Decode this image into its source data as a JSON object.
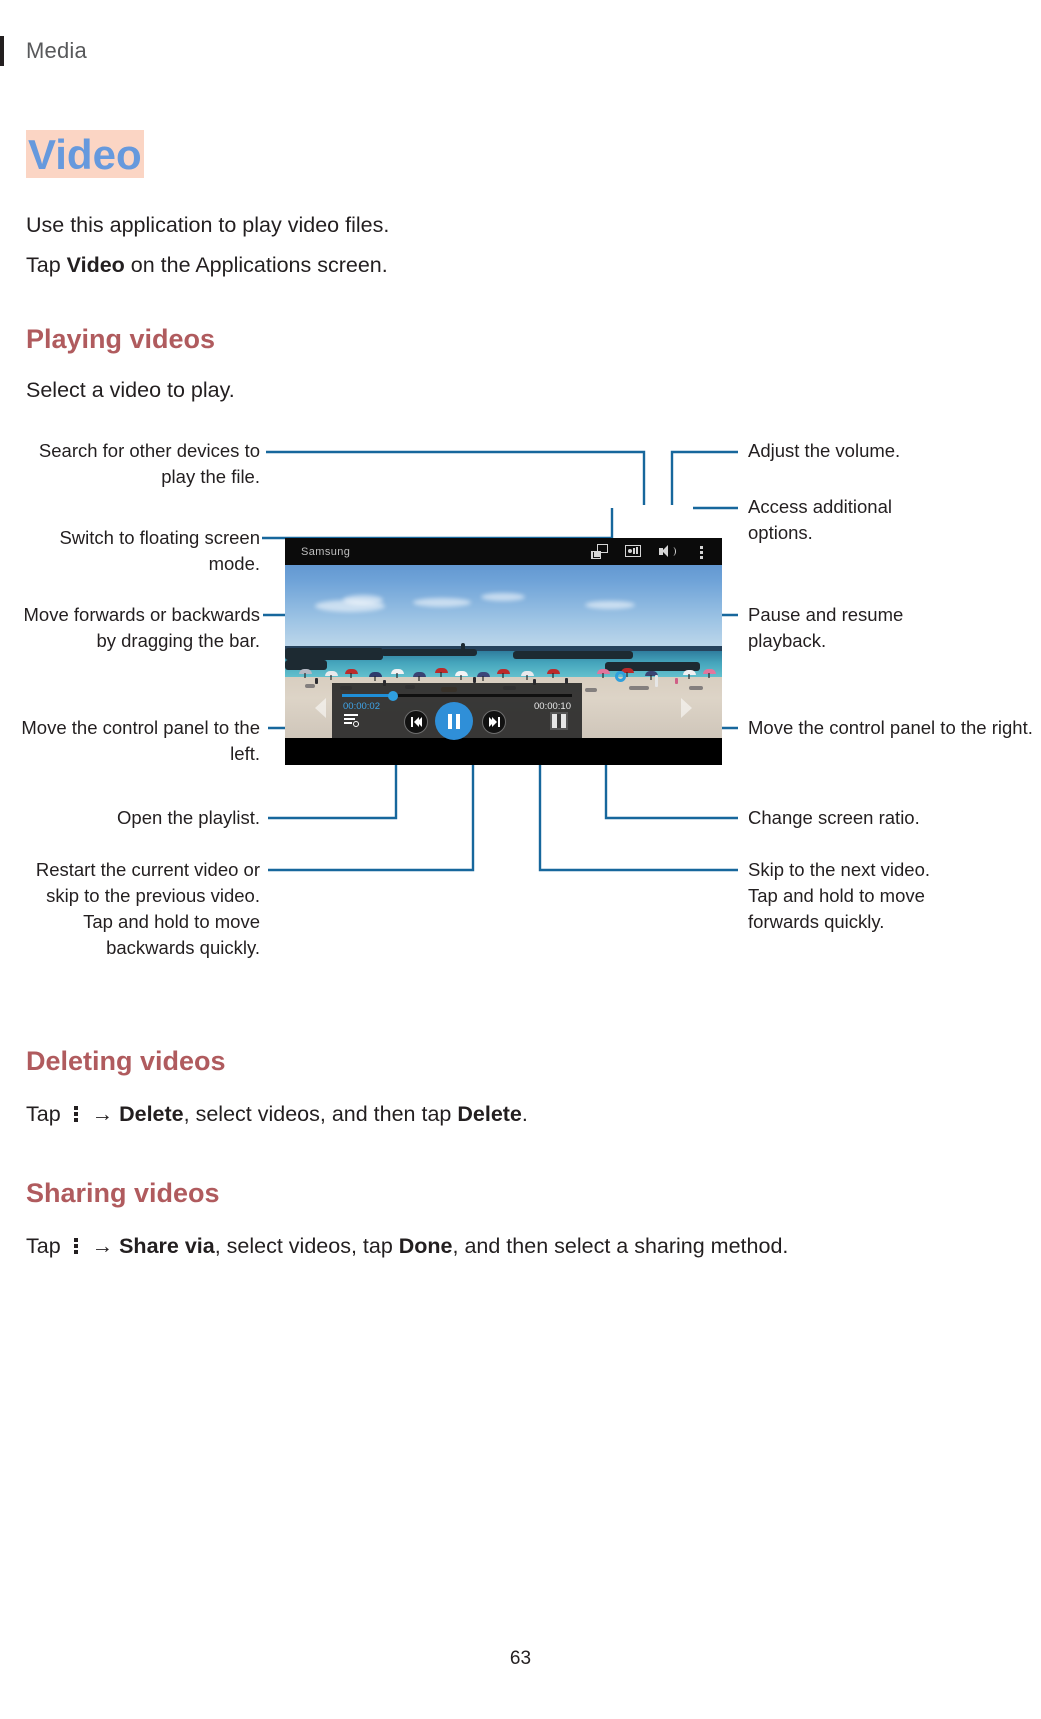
{
  "header": {
    "title": "Media"
  },
  "title": {
    "text": "Video",
    "color": "#6699dd",
    "highlight": "#fbd5c4"
  },
  "intro": {
    "line1": "Use this application to play video files.",
    "line2_pre": "Tap ",
    "line2_bold": "Video",
    "line2_post": " on the Applications screen."
  },
  "sections": {
    "playing": {
      "heading": "Playing videos",
      "body": "Select a video to play."
    },
    "deleting": {
      "heading": "Deleting videos",
      "pre": "Tap ",
      "arrow": " → ",
      "bold1": "Delete",
      "mid": ", select videos, and then tap ",
      "bold2": "Delete",
      "end": "."
    },
    "sharing": {
      "heading": "Sharing videos",
      "pre": "Tap ",
      "arrow": " → ",
      "bold1": "Share via",
      "mid": ", select videos, tap ",
      "bold2": "Done",
      "end": ", and then select a sharing method."
    }
  },
  "player": {
    "title": "Samsung",
    "current_time": "00:00:02",
    "total_time": "00:00:10",
    "progress_percent": 22,
    "accent_color": "#2f8fd8",
    "topbar_icons": [
      "floating-window-icon",
      "devices-icon",
      "volume-icon",
      "more-options-icon"
    ],
    "control_icons": [
      "playlist-icon",
      "previous-icon",
      "pause-icon",
      "next-icon",
      "screen-ratio-icon"
    ]
  },
  "callouts": {
    "left": [
      {
        "name": "search-devices",
        "text": "Search for other devices to play the file."
      },
      {
        "name": "floating-mode",
        "text": "Switch to floating screen mode."
      },
      {
        "name": "seek-bar",
        "text": "Move forwards or backwards by dragging the bar."
      },
      {
        "name": "panel-left",
        "text": "Move the control panel to the left."
      },
      {
        "name": "open-playlist",
        "text": "Open the playlist."
      },
      {
        "name": "restart-previous",
        "text": "Restart the current video or skip to the previous video. Tap and hold to move backwards quickly."
      }
    ],
    "right": [
      {
        "name": "adjust-volume",
        "text": "Adjust the volume."
      },
      {
        "name": "additional-options",
        "text": "Access additional options."
      },
      {
        "name": "pause-resume",
        "text": "Pause and resume playback."
      },
      {
        "name": "panel-right",
        "text": "Move the control panel to the right."
      },
      {
        "name": "screen-ratio",
        "text": "Change screen ratio."
      },
      {
        "name": "skip-next",
        "text": "Skip to the next video. Tap and hold to move forwards quickly."
      }
    ]
  },
  "footer": {
    "page_number": "63"
  }
}
